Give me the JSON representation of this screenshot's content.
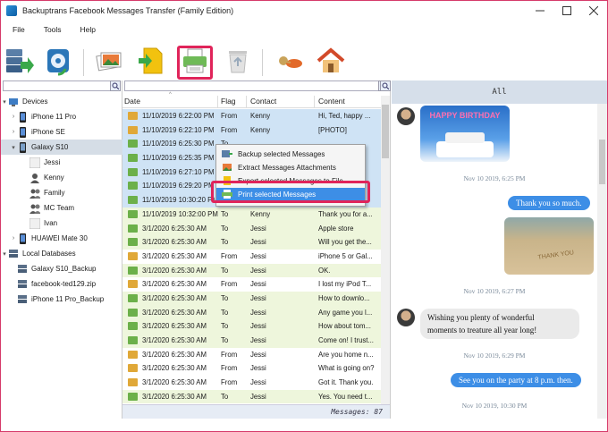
{
  "window": {
    "title": "Backuptrans Facebook Messages Transfer (Family Edition)",
    "controls": [
      "minimize",
      "maximize",
      "close"
    ]
  },
  "menu": [
    "File",
    "Tools",
    "Help"
  ],
  "toolbar": {
    "buttons": [
      {
        "name": "backup-to-computer-button",
        "icon": "server-arrow-icon"
      },
      {
        "name": "restore-to-device-button",
        "icon": "disk-sync-icon"
      },
      {
        "name": "export-photos-button",
        "icon": "photos-icon"
      },
      {
        "name": "export-file-button",
        "icon": "file-arrow-icon"
      },
      {
        "name": "print-button",
        "icon": "printer-icon",
        "highlighted": true
      },
      {
        "name": "delete-button",
        "icon": "recycle-bin-icon"
      },
      {
        "name": "settings-button",
        "icon": "key-icon"
      },
      {
        "name": "home-button",
        "icon": "house-icon"
      }
    ]
  },
  "tree": {
    "devices_label": "Devices",
    "devices": [
      "iPhone 11 Pro",
      "iPhone SE",
      "Galaxy S10"
    ],
    "contacts": [
      "Jessi",
      "Kenny",
      "Family",
      "MC Team",
      "Ivan"
    ],
    "other_device": "HUAWEI Mate 30",
    "local_label": "Local Databases",
    "local": [
      "Galaxy S10_Backup",
      "facebook-ted129.zip",
      "iPhone 11 Pro_Backup"
    ]
  },
  "columns": {
    "date": "Date",
    "flag": "Flag",
    "contact": "Contact",
    "content": "Content"
  },
  "messages": [
    {
      "date": "11/10/2019 6:22:00 PM",
      "flag": "From",
      "contact": "Kenny",
      "content": "Hi, Ted, happy ...",
      "sel": true
    },
    {
      "date": "11/10/2019 6:22:10 PM",
      "flag": "From",
      "contact": "Kenny",
      "content": "[PHOTO]",
      "sel": true
    },
    {
      "date": "11/10/2019 6:25:30 PM",
      "flag": "To",
      "contact": "",
      "content": "",
      "sel": true
    },
    {
      "date": "11/10/2019 6:25:35 PM",
      "flag": "",
      "contact": "",
      "content": "",
      "sel": true
    },
    {
      "date": "11/10/2019 6:27:10 PM",
      "flag": "",
      "contact": "",
      "content": "",
      "sel": true
    },
    {
      "date": "11/10/2019 6:29:20 PM",
      "flag": "",
      "contact": "",
      "content": "",
      "sel": true
    },
    {
      "date": "11/10/2019 10:30:20 PM",
      "flag": "",
      "contact": "",
      "content": "",
      "sel": true
    },
    {
      "date": "11/10/2019 10:32:00 PM",
      "flag": "To",
      "contact": "Kenny",
      "content": "Thank you for a...",
      "sel": false
    },
    {
      "date": "3/1/2020 6:25:30 AM",
      "flag": "To",
      "contact": "Jessi",
      "content": "Apple store",
      "sel": false
    },
    {
      "date": "3/1/2020 6:25:30 AM",
      "flag": "To",
      "contact": "Jessi",
      "content": "Will you get the...",
      "sel": false
    },
    {
      "date": "3/1/2020 6:25:30 AM",
      "flag": "From",
      "contact": "Jessi",
      "content": "iPhone 5 or Gal...",
      "sel": false
    },
    {
      "date": "3/1/2020 6:25:30 AM",
      "flag": "To",
      "contact": "Jessi",
      "content": "OK.",
      "sel": false
    },
    {
      "date": "3/1/2020 6:25:30 AM",
      "flag": "From",
      "contact": "Jessi",
      "content": "I lost my iPod T...",
      "sel": false
    },
    {
      "date": "3/1/2020 6:25:30 AM",
      "flag": "To",
      "contact": "Jessi",
      "content": "How to downlo...",
      "sel": false
    },
    {
      "date": "3/1/2020 6:25:30 AM",
      "flag": "To",
      "contact": "Jessi",
      "content": "Any game you l...",
      "sel": false
    },
    {
      "date": "3/1/2020 6:25:30 AM",
      "flag": "To",
      "contact": "Jessi",
      "content": "How about tom...",
      "sel": false
    },
    {
      "date": "3/1/2020 6:25:30 AM",
      "flag": "To",
      "contact": "Jessi",
      "content": "Come on! I trust...",
      "sel": false
    },
    {
      "date": "3/1/2020 6:25:30 AM",
      "flag": "From",
      "contact": "Jessi",
      "content": "Are you home n...",
      "sel": false
    },
    {
      "date": "3/1/2020 6:25:30 AM",
      "flag": "From",
      "contact": "Jessi",
      "content": "What is going on?",
      "sel": false
    },
    {
      "date": "3/1/2020 6:25:30 AM",
      "flag": "From",
      "contact": "Jessi",
      "content": "Got it. Thank you.",
      "sel": false
    },
    {
      "date": "3/1/2020 6:25:30 AM",
      "flag": "To",
      "contact": "Jessi",
      "content": "Yes. You need t...",
      "sel": false
    }
  ],
  "status": {
    "messages_count": "Messages: 87"
  },
  "context_menu": {
    "items": [
      "Backup selected Messages",
      "Extract Messages Attachments",
      "Export selected Messages to File",
      "Print selected Messages"
    ],
    "active_index": 3
  },
  "chat": {
    "header": "All",
    "photo1_text": "HAPPY BIRTHDAY",
    "ts1": "Nov 10 2019, 6:25 PM",
    "out1": "Thank you so much.",
    "photo2_text": "THANK YOU",
    "ts2": "Nov 10 2019, 6:27 PM",
    "in2_line1": "Wishing you plenty of wonderful",
    "in2_line2": "moments to treature all year long!",
    "ts3": "Nov 10 2019, 6:29 PM",
    "out3": "See you on the party at 8 p.m. then.",
    "ts4": "Nov 10 2019, 10:30 PM"
  },
  "colors": {
    "accent": "#3d8ee6",
    "highlight": "#e0245a",
    "sent_row": "#eef6dc",
    "selected_row": "#cfe3f5"
  }
}
